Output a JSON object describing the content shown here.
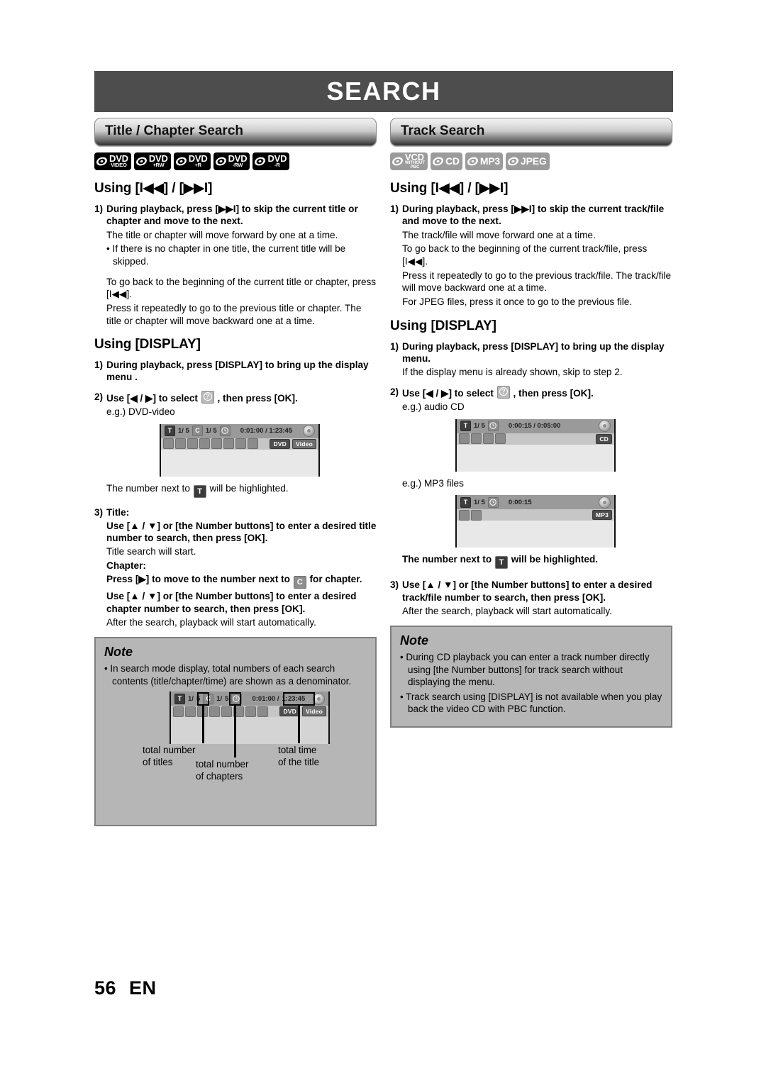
{
  "page": {
    "banner_title": "SEARCH",
    "footer_page": "56",
    "footer_lang": "EN"
  },
  "left_column": {
    "section_title": "Title / Chapter Search",
    "badges": [
      {
        "main": "DVD",
        "sub": "VIDEO",
        "style": "dark"
      },
      {
        "main": "DVD",
        "sub": "+RW",
        "style": "dark"
      },
      {
        "main": "DVD",
        "sub": "+R",
        "style": "dark"
      },
      {
        "main": "DVD",
        "sub": "-RW",
        "style": "dark"
      },
      {
        "main": "DVD",
        "sub": "-R",
        "style": "dark"
      }
    ],
    "using_skip_heading": "Using [I◀◀] / [▶▶I]",
    "step1_num": "1)",
    "step1_text": "During playback, press [▶▶I] to skip the current title or chapter and move to the next.",
    "step1_p1": "The title or chapter will move forward by one at a time.",
    "step1_bullet": "• If there is no chapter in one title, the current title will be skipped.",
    "step1_p2": "To go back to the beginning of the current title or chapter, press [I◀◀].",
    "step1_p3": "Press it repeatedly to go to the previous title or chapter. The title or chapter will move backward one at a time.",
    "using_display_heading": "Using [DISPLAY]",
    "d_step1_num": "1)",
    "d_step1_text": "During playback, press [DISPLAY] to bring up the display menu .",
    "d_step2_num": "2)",
    "d_step2_pre": "Use [◀ / ▶] to select",
    "d_step2_post": ", then press [OK].",
    "d_example_label": "e.g.) DVD-video",
    "osd_dvd": {
      "t_icon": "T",
      "t_value": "1/ 5",
      "c_icon": "C",
      "c_value": "1/ 5",
      "clock_icon": "clock",
      "time": "0:01:00 / 1:23:45",
      "tags": [
        "DVD",
        "Video"
      ]
    },
    "highlight_note": "The number next to",
    "highlight_note_end": "will be highlighted.",
    "step3_num": "3)",
    "step3_title_label": "Title:",
    "step3_title_instr": "Use [▲ / ▼] or [the Number buttons] to enter a desired title number to search, then press [OK].",
    "step3_title_result": "Title search will start.",
    "step3_chapter_label": "Chapter:",
    "step3_chapter_instr1_pre": "Press [▶] to move to the number next to",
    "step3_chapter_instr1_post": "for chapter.",
    "step3_chapter_instr2": "Use [▲ / ▼] or [the Number buttons] to enter a desired chapter number to search, then press [OK].",
    "step3_chapter_result": "After the search, playback will start automatically.",
    "note": {
      "title": "Note",
      "bullets": [
        "• In search mode display, total numbers of each search contents (title/chapter/time) are shown as a denominator."
      ],
      "diagram_osd": {
        "t_icon": "T",
        "t_value": "1/",
        "t_total": "5",
        "c_icon": "C",
        "c_value": "1/",
        "c_total": "5",
        "time_elapsed": "0:01:00 /",
        "time_total": "1:23:45",
        "tags": [
          "DVD",
          "Video"
        ]
      },
      "labels": {
        "total_titles": "total number\nof titles",
        "total_chapters": "total number\nof chapters",
        "total_time": "total time\nof the title"
      }
    }
  },
  "right_column": {
    "section_title": "Track Search",
    "badges": [
      {
        "main": "VCD",
        "sub": "WITHOUT",
        "sub2": "PBC",
        "style": "gray"
      },
      {
        "main": "CD",
        "sub": "",
        "style": "gray"
      },
      {
        "main": "MP3",
        "sub": "",
        "style": "gray"
      },
      {
        "main": "JPEG",
        "sub": "",
        "style": "gray"
      }
    ],
    "using_skip_heading": "Using [I◀◀] / [▶▶I]",
    "step1_num": "1)",
    "step1_text": "During playback, press [▶▶I] to skip the current track/file and move to the next.",
    "step1_p1": "The track/file will move forward one at a time.",
    "step1_p2": "To go back to the beginning of the current track/file, press [I◀◀].",
    "step1_p3": "Press it repeatedly to go to the previous track/file. The track/file will move backward one at a time.",
    "step1_p4": "For JPEG files, press it once to go to the previous file.",
    "using_display_heading": "Using [DISPLAY]",
    "d_step1_num": "1)",
    "d_step1_text": "During playback, press [DISPLAY] to bring up the display menu.",
    "d_step1_p": "If the display menu is already shown, skip to step 2.",
    "d_step2_num": "2)",
    "d_step2_pre": "Use [◀ / ▶] to select",
    "d_step2_post": ", then press [OK].",
    "cd_example_label": "e.g.) audio CD",
    "osd_cd": {
      "t_icon": "T",
      "t_value": "1/ 5",
      "clock_icon": "clock",
      "time": "0:00:15 / 0:05:00",
      "tags": [
        "CD"
      ]
    },
    "mp3_example_label": "e.g.) MP3 files",
    "osd_mp3": {
      "t_icon": "T",
      "t_value": "1/ 5",
      "clock_icon": "clock",
      "time": "0:00:15",
      "tags": [
        "MP3"
      ]
    },
    "highlight_note": "The number next to",
    "highlight_note_end": "will be highlighted.",
    "step3_num": "3)",
    "step3_text": "Use [▲ / ▼] or [the Number buttons] to enter a desired track/file number to search, then press [OK].",
    "step3_result": "After the search, playback will start automatically.",
    "note": {
      "title": "Note",
      "bullets": [
        "• During CD playback you can enter a track number directly using [the Number buttons] for track search without displaying the menu.",
        "• Track search using [DISPLAY] is not available when you play back the video CD with PBC function."
      ]
    }
  },
  "colors": {
    "banner_bg": "#4d4d4d",
    "note_bg": "#b6b6b6",
    "note_border": "#7e7e7e",
    "osd_header": "#9a9a9a",
    "osd_body": "#c6c6c6"
  }
}
